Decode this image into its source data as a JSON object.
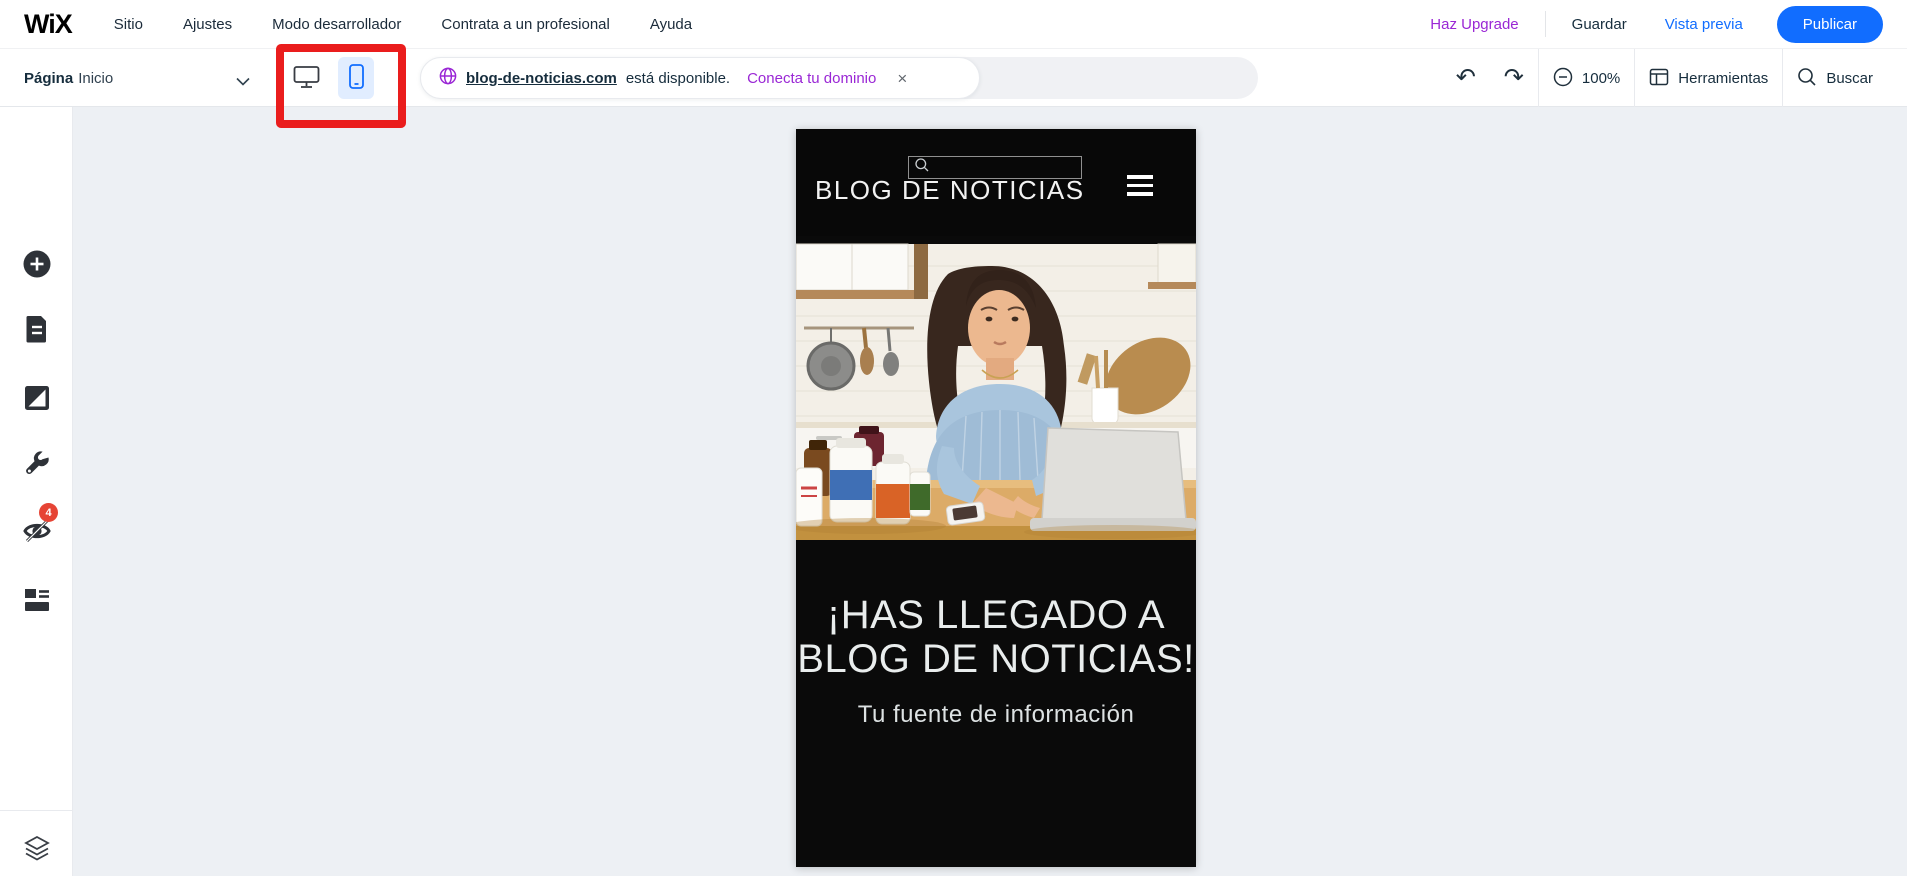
{
  "topbar": {
    "logo": "WiX",
    "menu": [
      {
        "label": "Sitio"
      },
      {
        "label": "Ajustes"
      },
      {
        "label": "Modo desarrollador"
      },
      {
        "label": "Contrata a un profesional"
      },
      {
        "label": "Ayuda"
      }
    ],
    "upgrade_label": "Haz Upgrade",
    "save_label": "Guardar",
    "preview_label": "Vista previa",
    "publish_label": "Publicar"
  },
  "toolbar": {
    "page_prefix": "Página",
    "page_name": "Inicio",
    "domain_bar": {
      "domain": "blog-de-noticias.com",
      "status": "está disponible.",
      "action": "Conecta tu dominio",
      "close": "×"
    },
    "undo_glyph": "↶",
    "redo_glyph": "↷",
    "zoom_level": "100%",
    "tools_label": "Herramientas",
    "search_label": "Buscar"
  },
  "sidebar": {
    "hidden_elements_count": "4",
    "icons": [
      "add-element-icon",
      "pages-icon",
      "media-icon",
      "tools-wrench-icon",
      "hidden-elements-icon",
      "layout-icon",
      "layers-icon"
    ]
  },
  "phone": {
    "header_title": "BLOG DE NOTICIAS",
    "hero_title_line1": "¡HAS LLEGADO A",
    "hero_title_line2": "BLOG DE NOTICIAS!",
    "hero_subtitle": "Tu fuente de información"
  },
  "colors": {
    "accent_blue": "#116dff",
    "accent_purple": "#9a27d5",
    "badge_red": "#e64435",
    "annotation_red": "#ea1d1d",
    "phone_black": "#0a0a0a",
    "canvas_gray": "#edf0f4"
  }
}
